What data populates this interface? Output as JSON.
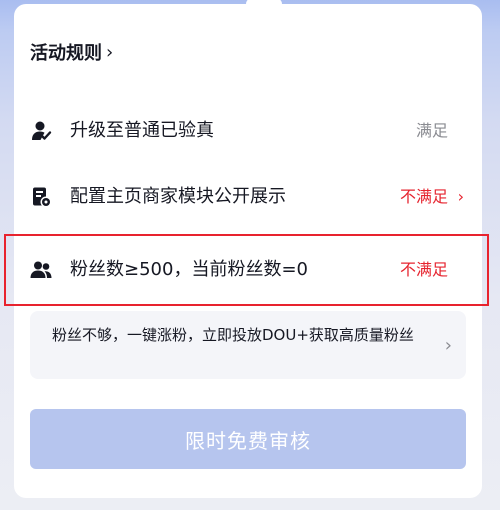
{
  "rules": {
    "label": "活动规则",
    "chevron": "›"
  },
  "requirements": [
    {
      "icon": "verified-user-icon",
      "text": "升级至普通已验真",
      "status": "满足",
      "status_color": "#8a8b91"
    },
    {
      "icon": "store-settings-icon",
      "text": "配置主页商家模块公开展示",
      "status": "不满足",
      "status_color": "#e6242f",
      "chevron": "›"
    },
    {
      "icon": "fans-icon",
      "text": "粉丝数≥500，当前粉丝数=0",
      "status": "不满足",
      "status_color": "#e6242f"
    }
  ],
  "promo": {
    "text": "粉丝不够，一键涨粉，立即投放DOU+获取高质量粉丝",
    "chevron": "›"
  },
  "submit": {
    "label": "限时免费审核",
    "color": "#b6c5ee"
  },
  "colors": {
    "accent_red": "#e6242f",
    "text_primary": "#161823",
    "text_muted": "#8a8b91"
  }
}
